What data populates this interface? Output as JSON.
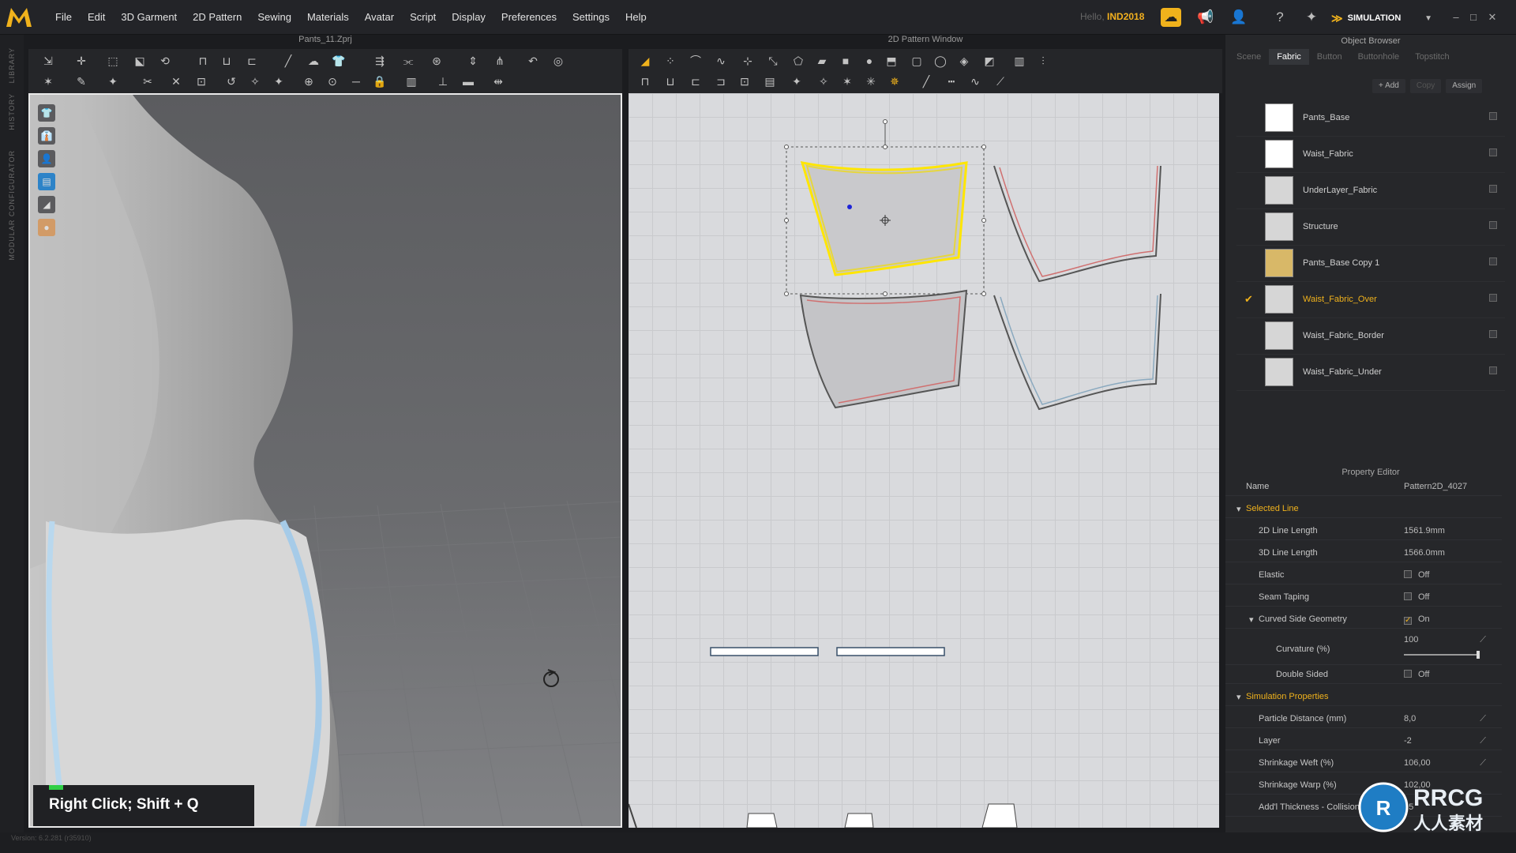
{
  "menu": [
    "File",
    "Edit",
    "3D Garment",
    "2D Pattern",
    "Sewing",
    "Materials",
    "Avatar",
    "Script",
    "Display",
    "Preferences",
    "Settings",
    "Help"
  ],
  "user": {
    "hello": "Hello,",
    "name": "IND2018"
  },
  "mode": "SIMULATION",
  "windows": {
    "view3d_title": "Pants_11.Zprj",
    "view2d_title": "2D Pattern Window",
    "hint": "Right Click; Shift + Q"
  },
  "left_strip": [
    "LIBRARY",
    "HISTORY",
    "MODULAR CONFIGURATOR"
  ],
  "object_browser": {
    "title": "Object Browser",
    "tabs": [
      "Scene",
      "Fabric",
      "Button",
      "Buttonhole",
      "Topstitch"
    ],
    "active_tab": "Fabric",
    "actions": [
      "+ Add",
      "Copy",
      "Assign"
    ],
    "fabrics": [
      {
        "name": "Pants_Base",
        "color": "#ffffff",
        "selected": false
      },
      {
        "name": "Waist_Fabric",
        "color": "#ffffff",
        "selected": false
      },
      {
        "name": "UnderLayer_Fabric",
        "color": "#d6d6d6",
        "selected": false
      },
      {
        "name": "Structure",
        "color": "#d6d6d6",
        "selected": false
      },
      {
        "name": "Pants_Base Copy 1",
        "color": "#d8b868",
        "selected": false
      },
      {
        "name": "Waist_Fabric_Over",
        "color": "#d6d6d6",
        "selected": true
      },
      {
        "name": "Waist_Fabric_Border",
        "color": "#d6d6d6",
        "selected": false
      },
      {
        "name": "Waist_Fabric_Under",
        "color": "#d6d6d6",
        "selected": false
      }
    ]
  },
  "property_editor": {
    "title": "Property Editor",
    "name_label": "Name",
    "name_value": "Pattern2D_4027",
    "selected_line": "Selected Line",
    "line_2d_label": "2D Line Length",
    "line_2d_value": "1561.9mm",
    "line_3d_label": "3D Line Length",
    "line_3d_value": "1566.0mm",
    "elastic_label": "Elastic",
    "elastic_value": "Off",
    "seam_label": "Seam Taping",
    "seam_value": "Off",
    "curved_label": "Curved Side Geometry",
    "curved_value": "On",
    "curvature_label": "Curvature (%)",
    "curvature_value": "100",
    "curvature_level": 1.0,
    "double_label": "Double Sided",
    "double_value": "Off",
    "sim_props": "Simulation Properties",
    "particle_label": "Particle Distance (mm)",
    "particle_value": "8,0",
    "layer_label": "Layer",
    "layer_value": "-2",
    "weft_label": "Shrinkage Weft (%)",
    "weft_value": "106,00",
    "warp_label": "Shrinkage Warp (%)",
    "warp_value": "102,00",
    "thick_label": "Add'l Thickness - Collision",
    "thick_value": "15"
  },
  "version": "Version: 6.2.281 (r35910)",
  "watermark": {
    "line1": "RRCG",
    "line2": "人人素材"
  },
  "colors": {
    "accent": "#f0b21c",
    "selection": "#ffe600",
    "seam": "#d07070"
  }
}
